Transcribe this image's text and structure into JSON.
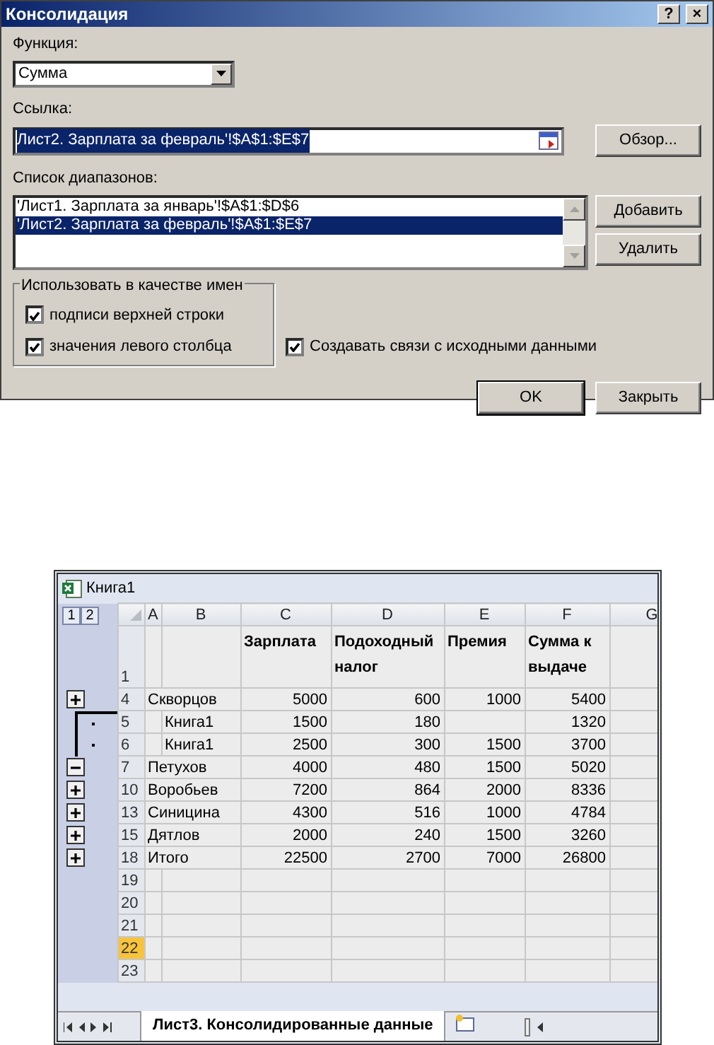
{
  "dialog": {
    "title": "Консолидация",
    "help_button": "?",
    "close_button": "×",
    "function": {
      "label": "Функция:",
      "value": "Сумма"
    },
    "reference": {
      "label": "Ссылка:",
      "value": "Лист2. Зарплата за февраль'!$A$1:$E$7",
      "text_selected": true
    },
    "browse_button": "Обзор...",
    "ranges": {
      "label": "Список диапазонов:",
      "items": [
        {
          "text": "'Лист1. Зарплата за январь'!$A$1:$D$6",
          "selected": false
        },
        {
          "text": "'Лист2. Зарплата за февраль'!$A$1:$E$7",
          "selected": true
        }
      ]
    },
    "add_button": "Добавить",
    "delete_button": "Удалить",
    "use_names": {
      "title": "Использовать в качестве имен",
      "options": [
        {
          "label": "подписи верхней строки",
          "checked": true
        },
        {
          "label": "значения левого столбца",
          "checked": true
        }
      ]
    },
    "create_links": {
      "label": "Создавать связи с исходными данными",
      "checked": true
    },
    "buttons": [
      {
        "label": "OK",
        "default": true
      },
      {
        "label": "Закрыть",
        "default": false
      }
    ]
  },
  "workbook": {
    "title": "Книга1",
    "outline_levels": [
      "1",
      "2"
    ],
    "columns": [
      "A",
      "B",
      "C",
      "D",
      "E",
      "F",
      "G"
    ],
    "rows": [
      {
        "number": "1",
        "kind": "header",
        "selected": false,
        "cells": [
          "",
          "",
          "Зарплата",
          "Подоходный налог",
          "Премия",
          "Сумма к выдаче"
        ]
      },
      {
        "number": "4",
        "kind": "expand",
        "selected": false,
        "cells": [
          "Скворцов",
          "",
          "5000",
          "600",
          "1000",
          "5400"
        ]
      },
      {
        "number": "5",
        "kind": "detail",
        "selected": false,
        "cells": [
          "",
          "Книга1",
          "1500",
          "180",
          "",
          "1320"
        ]
      },
      {
        "number": "6",
        "kind": "detail",
        "selected": false,
        "cells": [
          "",
          "Книга1",
          "2500",
          "300",
          "1500",
          "3700"
        ]
      },
      {
        "number": "7",
        "kind": "collapse",
        "selected": false,
        "cells": [
          "Петухов",
          "",
          "4000",
          "480",
          "1500",
          "5020"
        ]
      },
      {
        "number": "10",
        "kind": "expand",
        "selected": false,
        "cells": [
          "Воробьев",
          "",
          "7200",
          "864",
          "2000",
          "8336"
        ]
      },
      {
        "number": "13",
        "kind": "expand",
        "selected": false,
        "cells": [
          "Синицина",
          "",
          "4300",
          "516",
          "1000",
          "4784"
        ]
      },
      {
        "number": "15",
        "kind": "expand",
        "selected": false,
        "cells": [
          "Дятлов",
          "",
          "2000",
          "240",
          "1500",
          "3260"
        ]
      },
      {
        "number": "18",
        "kind": "expand",
        "selected": false,
        "cells": [
          "Итого",
          "",
          "22500",
          "2700",
          "7000",
          "26800"
        ]
      },
      {
        "number": "19",
        "kind": "plain",
        "selected": false,
        "cells": [
          "",
          "",
          "",
          "",
          "",
          ""
        ]
      },
      {
        "number": "20",
        "kind": "plain",
        "selected": false,
        "cells": [
          "",
          "",
          "",
          "",
          "",
          ""
        ]
      },
      {
        "number": "21",
        "kind": "plain",
        "selected": false,
        "cells": [
          "",
          "",
          "",
          "",
          "",
          ""
        ]
      },
      {
        "number": "22",
        "kind": "plain",
        "selected": true,
        "cells": [
          "",
          "",
          "",
          "",
          "",
          ""
        ]
      },
      {
        "number": "23",
        "kind": "plain",
        "selected": false,
        "cells": [
          "",
          "",
          "",
          "",
          "",
          ""
        ]
      }
    ],
    "sheet_tabs": [
      {
        "label": "Лист3. Консолидированные данные",
        "selected": true
      }
    ]
  }
}
